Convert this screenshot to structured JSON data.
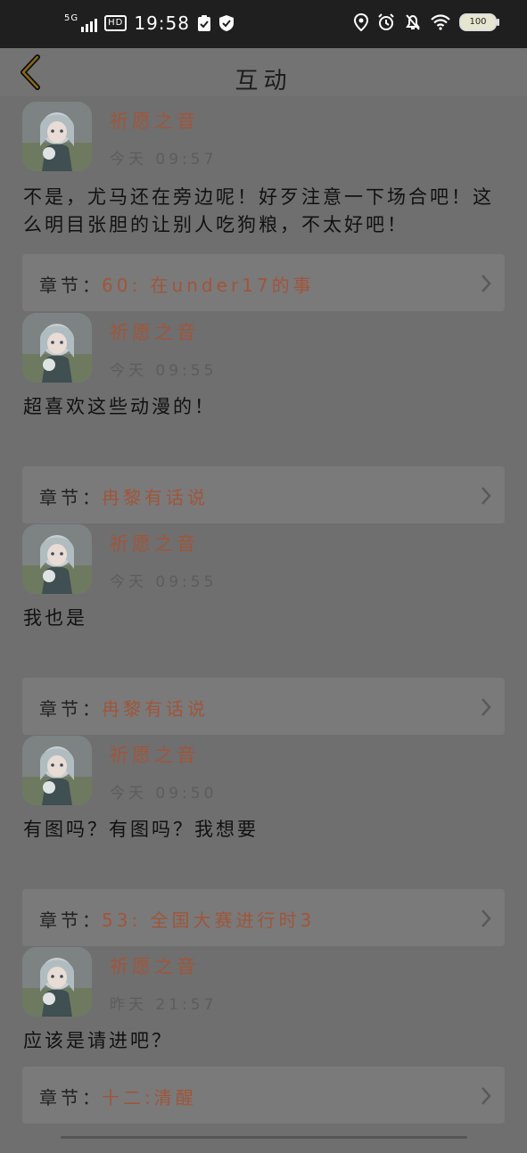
{
  "status_bar": {
    "network": "5G",
    "hd": "HD",
    "time": "19:58",
    "battery": "100"
  },
  "header": {
    "title": "互动"
  },
  "comments": [
    {
      "username": "祈愿之音",
      "time": "今天 09:57",
      "content": "不是，尤马还在旁边呢！好歹注意一下场合吧！这么明目张胆的让别人吃狗粮，不太好吧！",
      "chapter_label": "章节：",
      "chapter": "60: 在under17的事"
    },
    {
      "username": "祈愿之音",
      "time": "今天 09:55",
      "content": "超喜欢这些动漫的！",
      "chapter_label": "章节：",
      "chapter": "冉黎有话说"
    },
    {
      "username": "祈愿之音",
      "time": "今天 09:55",
      "content": "我也是",
      "chapter_label": "章节：",
      "chapter": "冉黎有话说"
    },
    {
      "username": "祈愿之音",
      "time": "今天 09:50",
      "content": "有图吗？有图吗？我想要",
      "chapter_label": "章节：",
      "chapter": "53: 全国大赛进行时3"
    },
    {
      "username": "祈愿之音",
      "time": "昨天 21:57",
      "content": "应该是请进吧？",
      "chapter_label": "章节：",
      "chapter": "十二:清醒"
    }
  ],
  "colors": {
    "accent": "#a0553a",
    "overlay_bg": "#6f6f6f",
    "status_bar": "#1f1f1f"
  },
  "icons": {
    "back": "back-chevron-icon",
    "chapter_arrow": "chevron-right-icon",
    "avatar": "anime-girl-avatar"
  }
}
